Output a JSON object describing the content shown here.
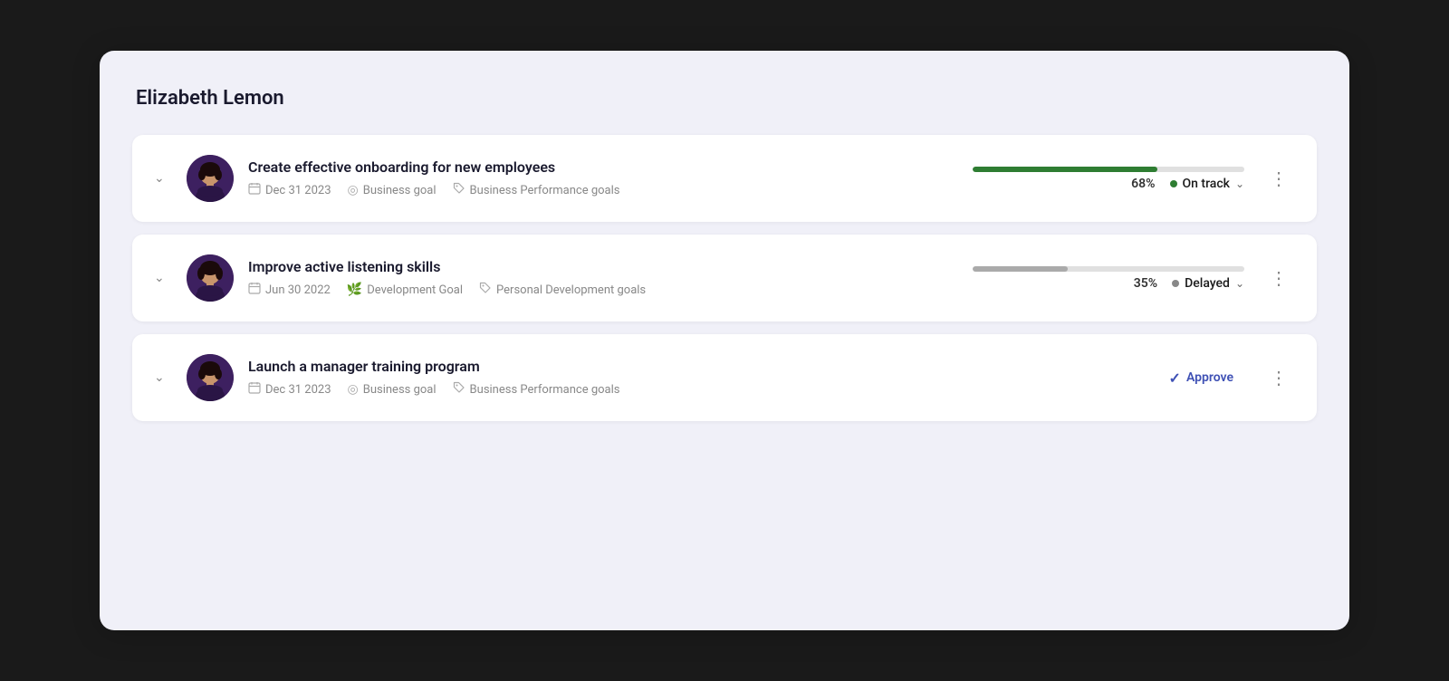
{
  "page": {
    "title": "Elizabeth Lemon"
  },
  "goals": [
    {
      "id": "goal-1",
      "title": "Create effective onboarding for new employees",
      "date": "Dec 31 2023",
      "goal_type": "Business goal",
      "goal_category": "Business Performance goals",
      "progress": 68,
      "progress_label": "68%",
      "status": "On track",
      "status_color": "green",
      "has_progress": true,
      "has_approve": false
    },
    {
      "id": "goal-2",
      "title": "Improve active listening skills",
      "date": "Jun 30 2022",
      "goal_type": "Development Goal",
      "goal_category": "Personal Development goals",
      "progress": 35,
      "progress_label": "35%",
      "status": "Delayed",
      "status_color": "gray",
      "has_progress": true,
      "has_approve": false
    },
    {
      "id": "goal-3",
      "title": "Launch a manager training program",
      "date": "Dec 31 2023",
      "goal_type": "Business goal",
      "goal_category": "Business Performance goals",
      "progress": 0,
      "progress_label": "",
      "status": "",
      "status_color": "",
      "has_progress": false,
      "has_approve": true,
      "approve_label": "Approve"
    }
  ],
  "icons": {
    "calendar": "📅",
    "target": "◎",
    "tag": "🏷",
    "seedling": "🌱",
    "chevron_down": "›",
    "more": "⋮",
    "check": "✓"
  }
}
